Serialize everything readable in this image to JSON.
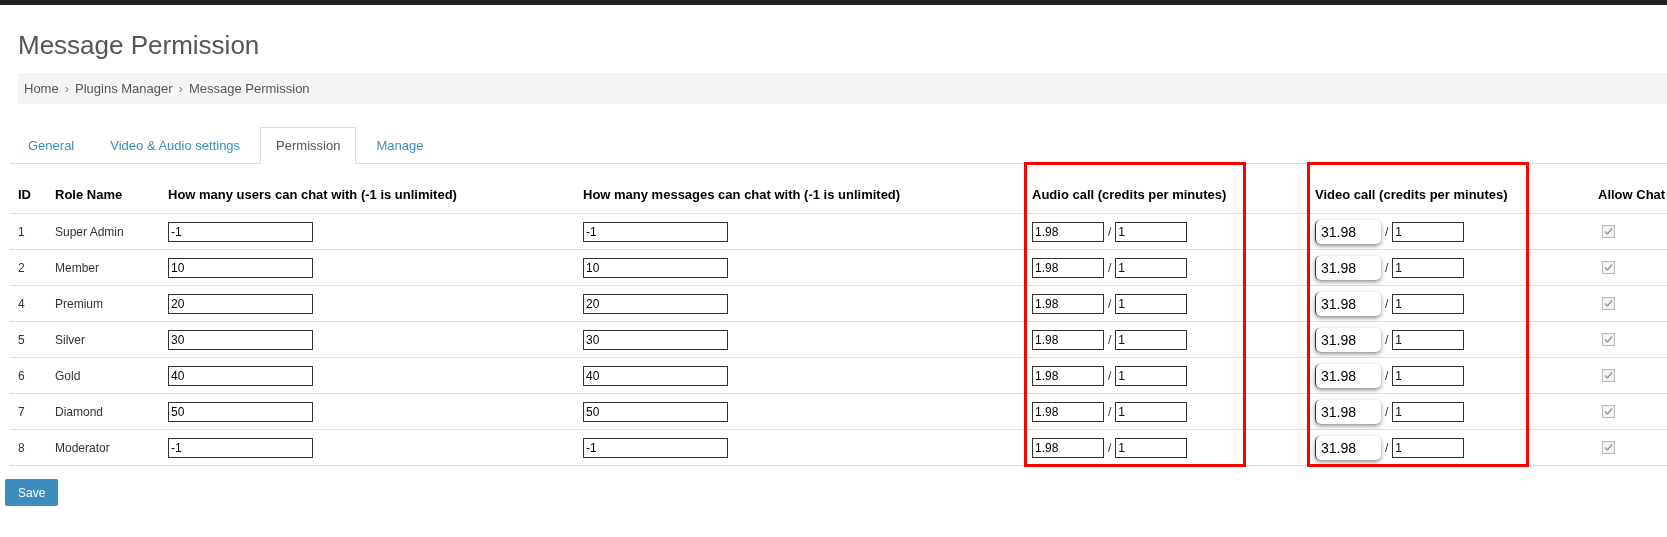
{
  "page_title": "Message Permission",
  "breadcrumb": [
    "Home",
    "Plugins Manager",
    "Message Permission"
  ],
  "breadcrumb_separator": "›",
  "tabs": [
    {
      "label": "General",
      "selected": false
    },
    {
      "label": "Video & Audio settings",
      "selected": false
    },
    {
      "label": "Permission",
      "selected": true
    },
    {
      "label": "Manage",
      "selected": false
    }
  ],
  "table": {
    "columns": [
      {
        "label": "ID",
        "highlighted": false
      },
      {
        "label": "Role Name",
        "highlighted": false
      },
      {
        "label": "How many users can chat with (-1 is unlimited)",
        "highlighted": false
      },
      {
        "label": "How many messages can chat with (-1 is unlimited)",
        "highlighted": false
      },
      {
        "label": "Audio call (credits per minutes)",
        "highlighted": true
      },
      {
        "label": "Video call (credits per minutes)",
        "highlighted": true
      },
      {
        "label": "Allow Chat",
        "highlighted": false
      }
    ],
    "rows": [
      {
        "id": "1",
        "role": "Super Admin",
        "users": "-1",
        "messages": "-1",
        "audio_credits": "1.98",
        "audio_minutes": "1",
        "video_credits": "31.98",
        "video_minutes": "1",
        "allow_chat": true
      },
      {
        "id": "2",
        "role": "Member",
        "users": "10",
        "messages": "10",
        "audio_credits": "1.98",
        "audio_minutes": "1",
        "video_credits": "31.98",
        "video_minutes": "1",
        "allow_chat": true
      },
      {
        "id": "4",
        "role": "Premium",
        "users": "20",
        "messages": "20",
        "audio_credits": "1.98",
        "audio_minutes": "1",
        "video_credits": "31.98",
        "video_minutes": "1",
        "allow_chat": true
      },
      {
        "id": "5",
        "role": "Silver",
        "users": "30",
        "messages": "30",
        "audio_credits": "1.98",
        "audio_minutes": "1",
        "video_credits": "31.98",
        "video_minutes": "1",
        "allow_chat": true
      },
      {
        "id": "6",
        "role": "Gold",
        "users": "40",
        "messages": "40",
        "audio_credits": "1.98",
        "audio_minutes": "1",
        "video_credits": "31.98",
        "video_minutes": "1",
        "allow_chat": true
      },
      {
        "id": "7",
        "role": "Diamond",
        "users": "50",
        "messages": "50",
        "audio_credits": "1.98",
        "audio_minutes": "1",
        "video_credits": "31.98",
        "video_minutes": "1",
        "allow_chat": true
      },
      {
        "id": "8",
        "role": "Moderator",
        "users": "-1",
        "messages": "-1",
        "audio_credits": "1.98",
        "audio_minutes": "1",
        "video_credits": "31.98",
        "video_minutes": "1",
        "allow_chat": true
      }
    ],
    "ratio_separator": "/"
  },
  "save_button": "Save"
}
